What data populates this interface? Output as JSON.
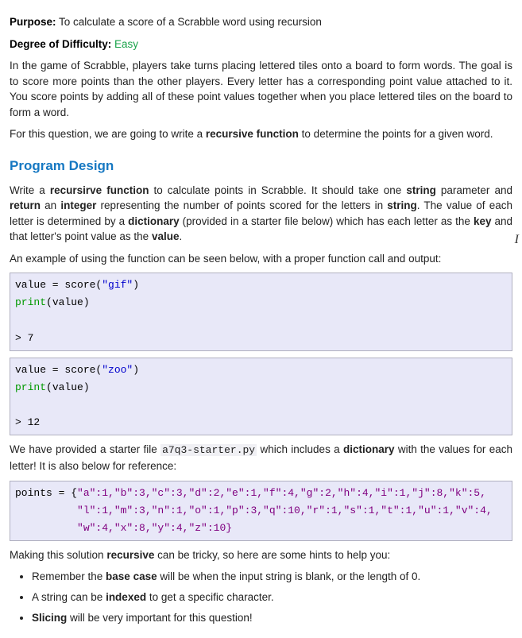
{
  "meta": {
    "purpose_label": "Purpose:",
    "purpose_text": "  To calculate a score of a Scrabble word using recursion",
    "difficulty_label": "Degree of Difficulty:",
    "difficulty_text": "  Easy",
    "cursor": "I"
  },
  "intro": {
    "p1": "In the game of Scrabble, players take turns placing lettered tiles onto a board to form words. The goal is to score more points than the other players.  Every letter has a corresponding point value attached to it.  You score points by adding all of these point values together when you place lettered tiles on the board to form a word.",
    "p2a": "For this question, we are going to write a ",
    "p2b": "recursive function",
    "p2c": " to determine the points for a given word."
  },
  "design": {
    "heading": "Program Design",
    "p1a": "Write a ",
    "p1b": "recursirve function",
    "p1c": " to calculate points in Scrabble. It should take one ",
    "p1d": "string",
    "p1e": " parameter and ",
    "p1f": "return",
    "p1g": " an ",
    "p1h": "integer",
    "p1i": " representing the number of points scored for the letters in ",
    "p1j": "string",
    "p1k": ".  The value of each letter is determined by a ",
    "p1l": "dictionary",
    "p1m": " (provided in a starter file below) which has each letter as the ",
    "p1n": "key",
    "p1o": " and that letter's point value as the ",
    "p1p": "value",
    "p1q": ".",
    "example_intro": "An example of using the function can be seen below, with a proper function call and output:"
  },
  "code1": {
    "l1a": "value = score(",
    "l1b": "\"gif\"",
    "l1c": ")",
    "l2a": "print",
    "l2b": "(value)",
    "blank": "",
    "out": "> 7"
  },
  "code2": {
    "l1a": "value = score(",
    "l1b": "\"zoo\"",
    "l1c": ")",
    "l2a": "print",
    "l2b": "(value)",
    "blank": "",
    "out": "> 12"
  },
  "starter": {
    "p1a": "We have provided a starter file ",
    "p1b": "a7q3-starter.py",
    "p1c": " which includes a ",
    "p1d": "dictionary",
    "p1e": " with the values for each letter! It is also below for reference:"
  },
  "code3": {
    "l1a": "points = {",
    "l1b": "\"a\":1,\"b\":3,\"c\":3,\"d\":2,\"e\":1,\"f\":4,\"g\":2,\"h\":4,\"i\":1,\"j\":8,\"k\":5,",
    "l2a": "          ",
    "l2b": "\"l\":1,\"m\":3,\"n\":1,\"o\":1,\"p\":3,\"q\":10,\"r\":1,\"s\":1,\"t\":1,\"u\":1,\"v\":4,",
    "l3a": "          ",
    "l3b": "\"w\":4,\"x\":8,\"y\":4,\"z\":10}"
  },
  "hints": {
    "intro_a": "Making this solution ",
    "intro_b": "recursive",
    "intro_c": " can be tricky, so here are some hints to help you:",
    "li1_a": "Remember the ",
    "li1_b": "base case",
    "li1_c": " will be when the input string is blank, or the length of 0.",
    "li2_a": "A string can be ",
    "li2_b": "indexed",
    "li2_c": " to get a specific character.",
    "li3_a": "Slicing",
    "li3_b": " will be very important for this question!"
  }
}
